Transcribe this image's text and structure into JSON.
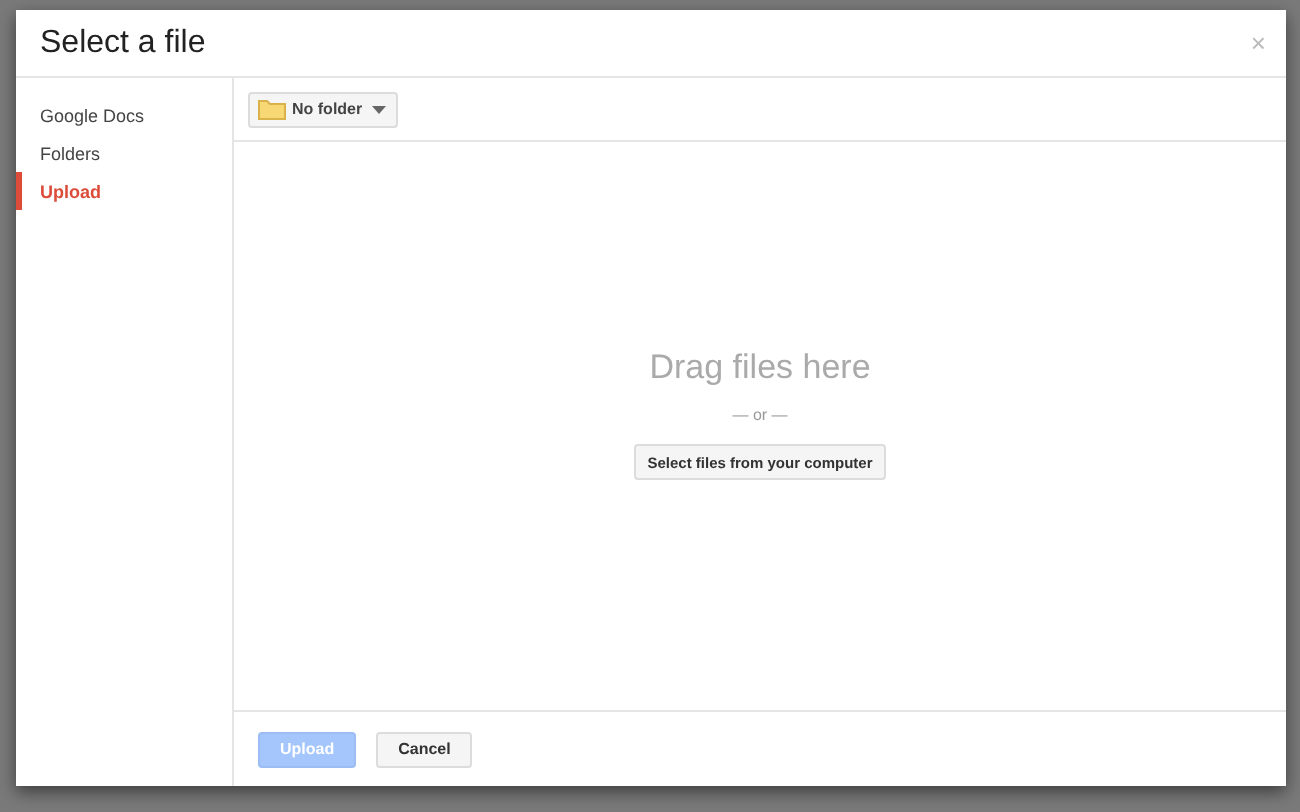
{
  "dialog": {
    "title": "Select a file",
    "close": "×"
  },
  "sidebar": {
    "items": [
      {
        "label": "Google Docs",
        "selected": false
      },
      {
        "label": "Folders",
        "selected": false
      },
      {
        "label": "Upload",
        "selected": true
      }
    ]
  },
  "toolbar": {
    "folder_dropdown": "No folder"
  },
  "drop_zone": {
    "heading": "Drag files here",
    "separator": "— or —",
    "button": "Select files from your computer"
  },
  "footer": {
    "buttons": [
      {
        "label": "Upload",
        "kind": "primary",
        "disabled": true
      },
      {
        "label": "Cancel",
        "kind": "secondary",
        "disabled": false
      }
    ]
  }
}
